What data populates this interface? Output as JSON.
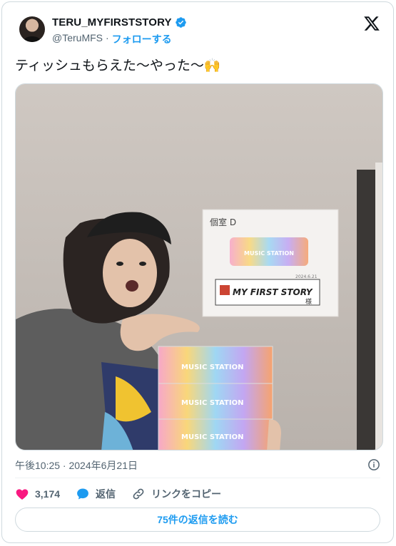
{
  "account": {
    "display_name": "TERU_MYFIRSTSTORY",
    "handle": "@TeruMFS",
    "separator": "·",
    "follow_label": "フォローする"
  },
  "tweet": {
    "text": "ティッシュもらえた〜やった〜🙌"
  },
  "photo": {
    "room_sign": "個室 D",
    "sign_logo": "MUSIC STATION",
    "sign_name": "MY FIRST STORY",
    "sign_suffix": "様",
    "sign_date": "2024.6.21",
    "box_label": "MUSIC STATION"
  },
  "meta": {
    "timestamp": "午後10:25 · 2024年6月21日"
  },
  "actions": {
    "like_count": "3,174",
    "reply_label": "返信",
    "copy_link_label": "リンクをコピー"
  },
  "read_replies_label": "75件の返信を読む",
  "colors": {
    "accent": "#1d9bf0",
    "like": "#f91880",
    "muted": "#536471"
  }
}
